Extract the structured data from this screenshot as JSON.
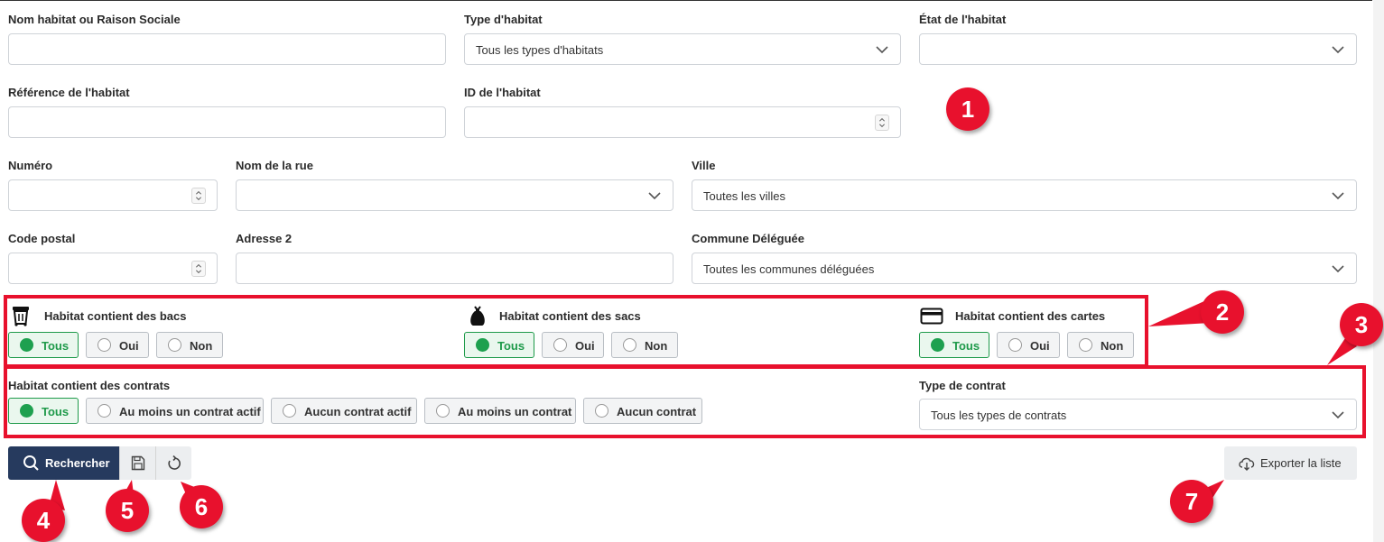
{
  "fields": {
    "nom_habitat": {
      "label": "Nom habitat ou Raison Sociale",
      "value": ""
    },
    "type_habitat": {
      "label": "Type d'habitat",
      "value": "Tous les types d'habitats"
    },
    "etat_habitat": {
      "label": "État de l'habitat",
      "value": ""
    },
    "reference": {
      "label": "Référence de l'habitat",
      "value": ""
    },
    "id_habitat": {
      "label": "ID de l'habitat",
      "value": ""
    },
    "numero": {
      "label": "Numéro",
      "value": ""
    },
    "nom_rue": {
      "label": "Nom de la rue",
      "value": ""
    },
    "ville": {
      "label": "Ville",
      "value": "Toutes les villes"
    },
    "code_postal": {
      "label": "Code postal",
      "value": ""
    },
    "adresse2": {
      "label": "Adresse 2",
      "value": ""
    },
    "commune": {
      "label": "Commune Déléguée",
      "value": "Toutes les communes déléguées"
    }
  },
  "filters": {
    "bacs": {
      "label": "Habitat contient des bacs",
      "icon": "bin-icon",
      "options": [
        "Tous",
        "Oui",
        "Non"
      ],
      "selected": "Tous"
    },
    "sacs": {
      "label": "Habitat contient des sacs",
      "icon": "bag-icon",
      "options": [
        "Tous",
        "Oui",
        "Non"
      ],
      "selected": "Tous"
    },
    "cartes": {
      "label": "Habitat contient des cartes",
      "icon": "card-icon",
      "options": [
        "Tous",
        "Oui",
        "Non"
      ],
      "selected": "Tous"
    },
    "contrats": {
      "label": "Habitat contient des contrats",
      "options": [
        "Tous",
        "Au moins un contrat actif",
        "Aucun contrat actif",
        "Au moins un contrat",
        "Aucun contrat"
      ],
      "selected": "Tous"
    },
    "type_contrat": {
      "label": "Type de contrat",
      "value": "Tous les types de contrats"
    }
  },
  "actions": {
    "search": "Rechercher",
    "save_icon": "save-icon",
    "reset_icon": "reset-icon",
    "export": "Exporter la liste",
    "export_icon": "cloud-download-icon"
  },
  "annotations": {
    "badges": [
      "1",
      "2",
      "3",
      "4",
      "5",
      "6",
      "7"
    ],
    "color": "#e8112d"
  },
  "colors": {
    "primary": "#263a5e",
    "selected_green": "#1ea04f"
  }
}
